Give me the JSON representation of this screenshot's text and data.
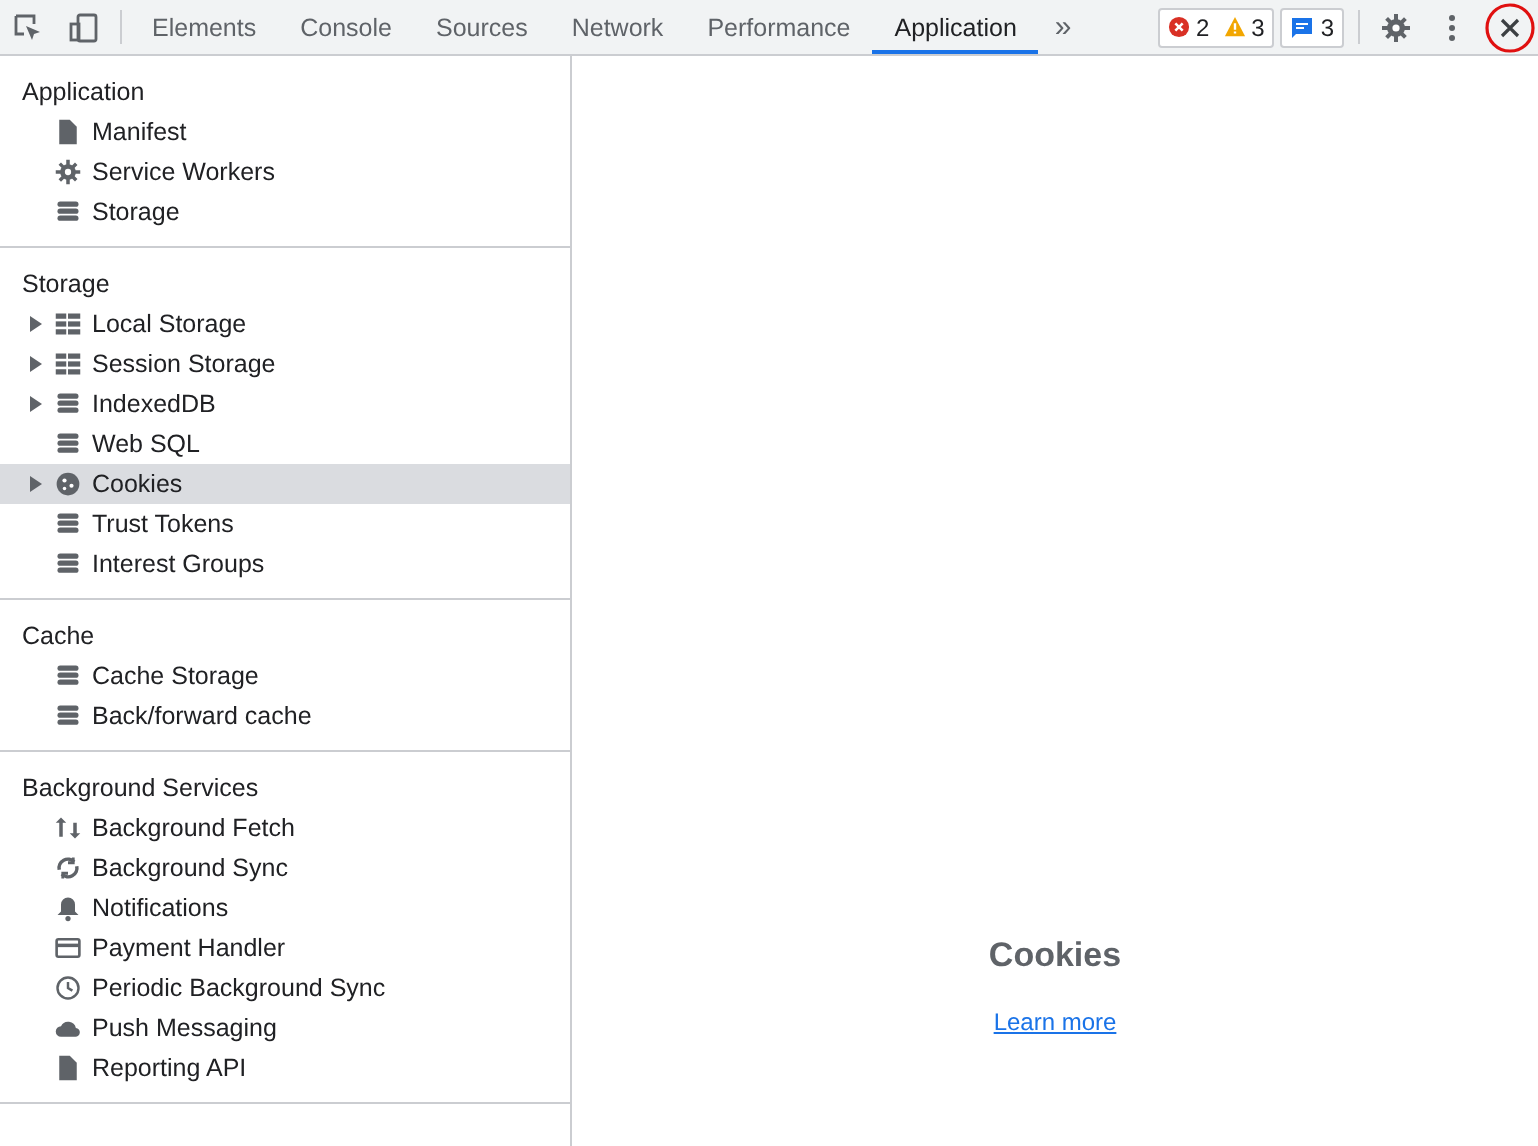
{
  "toolbar": {
    "tabs": [
      {
        "label": "Elements",
        "selected": false
      },
      {
        "label": "Console",
        "selected": false
      },
      {
        "label": "Sources",
        "selected": false
      },
      {
        "label": "Network",
        "selected": false
      },
      {
        "label": "Performance",
        "selected": false
      },
      {
        "label": "Application",
        "selected": true
      }
    ],
    "more": "»",
    "errors": "2",
    "warnings": "3",
    "messages": "3"
  },
  "sidebar": {
    "sections": [
      {
        "title": "Application",
        "items": [
          {
            "label": "Manifest",
            "kind": "file",
            "expandable": false,
            "selected": false
          },
          {
            "label": "Service Workers",
            "kind": "gear",
            "expandable": false,
            "selected": false
          },
          {
            "label": "Storage",
            "kind": "db",
            "expandable": false,
            "selected": false
          }
        ]
      },
      {
        "title": "Storage",
        "items": [
          {
            "label": "Local Storage",
            "kind": "grid",
            "expandable": true,
            "selected": false
          },
          {
            "label": "Session Storage",
            "kind": "grid",
            "expandable": true,
            "selected": false
          },
          {
            "label": "IndexedDB",
            "kind": "db",
            "expandable": true,
            "selected": false
          },
          {
            "label": "Web SQL",
            "kind": "db",
            "expandable": false,
            "selected": false
          },
          {
            "label": "Cookies",
            "kind": "cookie",
            "expandable": true,
            "selected": true
          },
          {
            "label": "Trust Tokens",
            "kind": "db",
            "expandable": false,
            "selected": false
          },
          {
            "label": "Interest Groups",
            "kind": "db",
            "expandable": false,
            "selected": false
          }
        ]
      },
      {
        "title": "Cache",
        "items": [
          {
            "label": "Cache Storage",
            "kind": "db",
            "expandable": false,
            "selected": false
          },
          {
            "label": "Back/forward cache",
            "kind": "db",
            "expandable": false,
            "selected": false
          }
        ]
      },
      {
        "title": "Background Services",
        "items": [
          {
            "label": "Background Fetch",
            "kind": "arrows",
            "expandable": false,
            "selected": false
          },
          {
            "label": "Background Sync",
            "kind": "sync",
            "expandable": false,
            "selected": false
          },
          {
            "label": "Notifications",
            "kind": "bell",
            "expandable": false,
            "selected": false
          },
          {
            "label": "Payment Handler",
            "kind": "card",
            "expandable": false,
            "selected": false
          },
          {
            "label": "Periodic Background Sync",
            "kind": "clock",
            "expandable": false,
            "selected": false
          },
          {
            "label": "Push Messaging",
            "kind": "cloud",
            "expandable": false,
            "selected": false
          },
          {
            "label": "Reporting API",
            "kind": "file",
            "expandable": false,
            "selected": false
          }
        ]
      }
    ]
  },
  "main": {
    "title": "Cookies",
    "link": "Learn more"
  }
}
